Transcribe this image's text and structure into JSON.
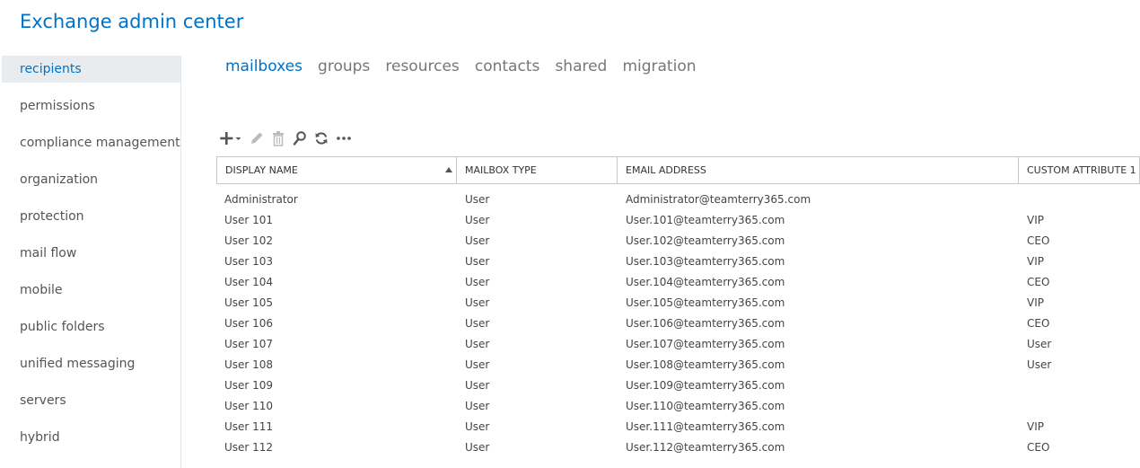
{
  "app": {
    "title": "Exchange admin center"
  },
  "sidebar": {
    "items": [
      {
        "label": "recipients",
        "active": true
      },
      {
        "label": "permissions"
      },
      {
        "label": "compliance management"
      },
      {
        "label": "organization"
      },
      {
        "label": "protection"
      },
      {
        "label": "mail flow"
      },
      {
        "label": "mobile"
      },
      {
        "label": "public folders"
      },
      {
        "label": "unified messaging"
      },
      {
        "label": "servers"
      },
      {
        "label": "hybrid"
      }
    ]
  },
  "tabs": [
    {
      "label": "mailboxes",
      "active": true
    },
    {
      "label": "groups"
    },
    {
      "label": "resources"
    },
    {
      "label": "contacts"
    },
    {
      "label": "shared"
    },
    {
      "label": "migration"
    }
  ],
  "toolbar": {
    "icons": [
      "add-icon",
      "edit-icon",
      "delete-icon",
      "search-icon",
      "refresh-icon",
      "more-icon"
    ]
  },
  "colors": {
    "accent": "#0072c6",
    "selected_bg": "#e9ecef",
    "icon": "#555555",
    "icon_disabled": "#bbbbbb"
  },
  "table": {
    "columns": [
      "DISPLAY NAME",
      "MAILBOX TYPE",
      "EMAIL ADDRESS",
      "CUSTOM ATTRIBUTE 1"
    ],
    "sort": {
      "column": "DISPLAY NAME",
      "direction": "ascending"
    },
    "rows": [
      [
        "Administrator",
        "User",
        "Administrator@teamterry365.com",
        ""
      ],
      [
        "User 101",
        "User",
        "User.101@teamterry365.com",
        "VIP"
      ],
      [
        "User 102",
        "User",
        "User.102@teamterry365.com",
        "CEO"
      ],
      [
        "User 103",
        "User",
        "User.103@teamterry365.com",
        "VIP"
      ],
      [
        "User 104",
        "User",
        "User.104@teamterry365.com",
        "CEO"
      ],
      [
        "User 105",
        "User",
        "User.105@teamterry365.com",
        "VIP"
      ],
      [
        "User 106",
        "User",
        "User.106@teamterry365.com",
        "CEO"
      ],
      [
        "User 107",
        "User",
        "User.107@teamterry365.com",
        "User"
      ],
      [
        "User 108",
        "User",
        "User.108@teamterry365.com",
        "User"
      ],
      [
        "User 109",
        "User",
        "User.109@teamterry365.com",
        ""
      ],
      [
        "User 110",
        "User",
        "User.110@teamterry365.com",
        ""
      ],
      [
        "User 111",
        "User",
        "User.111@teamterry365.com",
        "VIP"
      ],
      [
        "User 112",
        "User",
        "User.112@teamterry365.com",
        "CEO"
      ]
    ]
  }
}
